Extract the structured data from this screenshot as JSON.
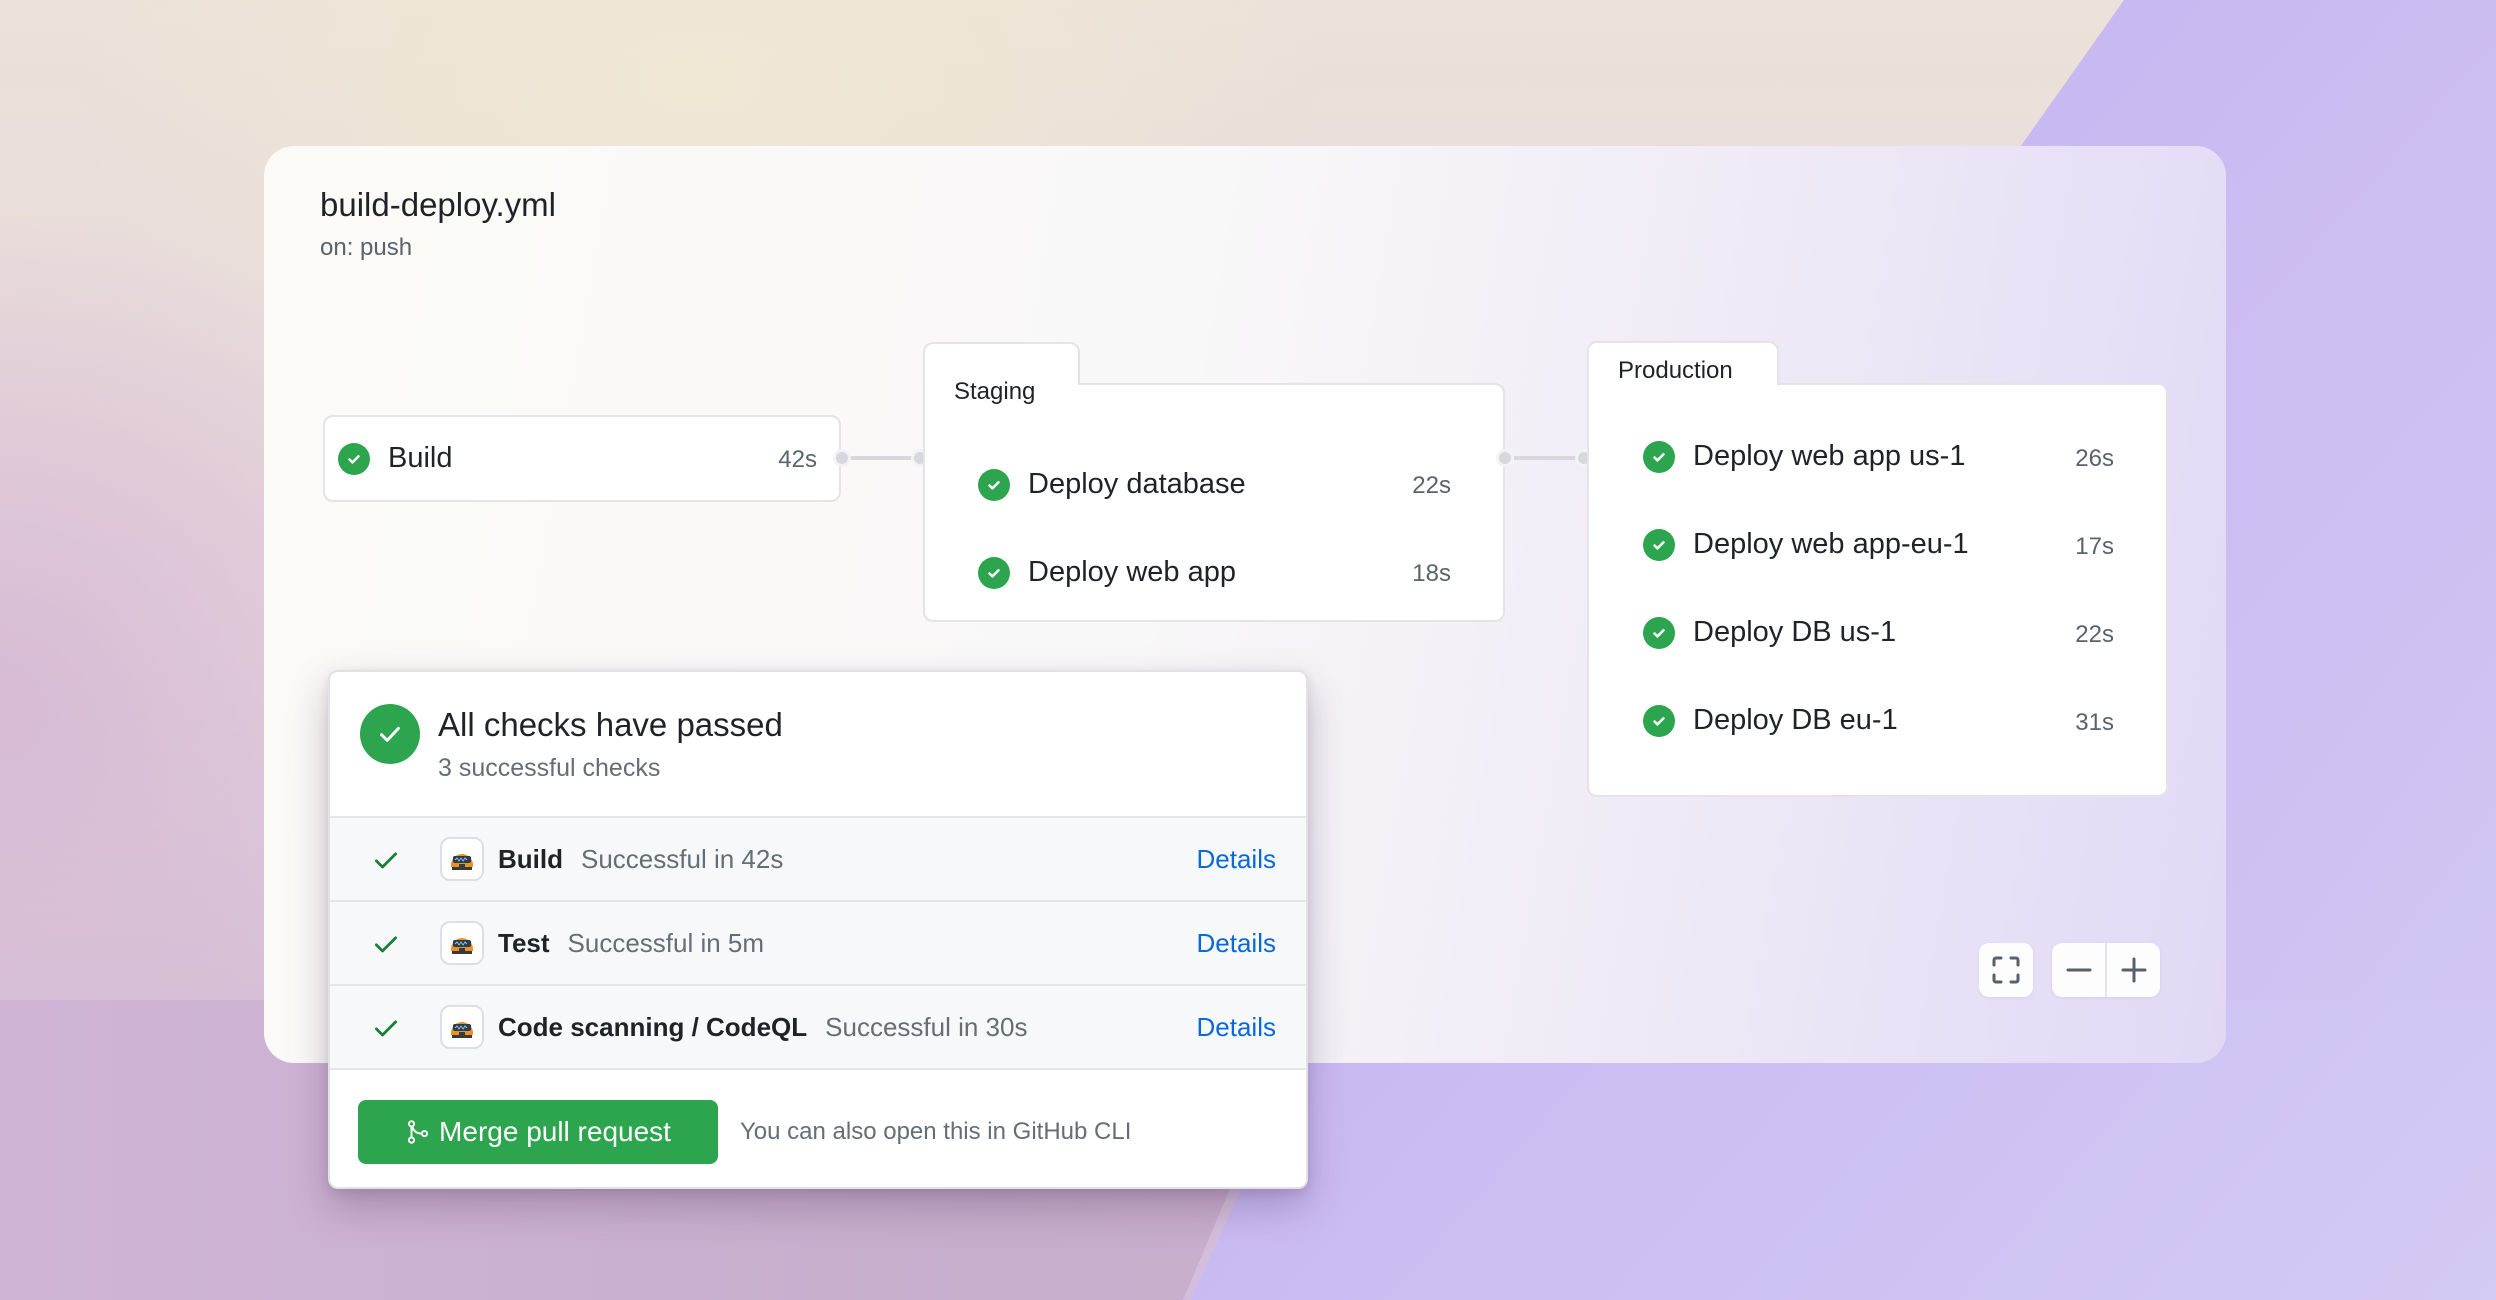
{
  "workflow": {
    "title": "build-deploy.yml",
    "trigger": "on: push"
  },
  "build_job": {
    "name": "Build",
    "duration": "42s",
    "status": "success",
    "icon": "check-circle-icon"
  },
  "groups": [
    {
      "label": "Staging",
      "jobs": [
        {
          "name": "Deploy database",
          "duration": "22s",
          "status": "success"
        },
        {
          "name": "Deploy web app",
          "duration": "18s",
          "status": "success"
        }
      ]
    },
    {
      "label": "Production",
      "jobs": [
        {
          "name": "Deploy web app us-1",
          "duration": "26s",
          "status": "success"
        },
        {
          "name": "Deploy web app-eu-1",
          "duration": "17s",
          "status": "success"
        },
        {
          "name": "Deploy DB us-1",
          "duration": "22s",
          "status": "success"
        },
        {
          "name": "Deploy DB eu-1",
          "duration": "31s",
          "status": "success"
        }
      ]
    }
  ],
  "zoom_controls": {
    "fullscreen_icon": "fullscreen-icon",
    "zoom_out_icon": "minus-icon",
    "zoom_in_icon": "plus-icon"
  },
  "checks": {
    "title": "All checks have passed",
    "subtitle": "3 successful checks",
    "rows": [
      {
        "name": "Build",
        "status": "Successful in 42s",
        "link": "Details"
      },
      {
        "name": "Test",
        "status": "Successful in 5m",
        "link": "Details"
      },
      {
        "name": "Code scanning / CodeQL",
        "status": "Successful in 30s",
        "link": "Details"
      }
    ],
    "merge_button": "Merge pull request",
    "cli_note": "You can also open this in GitHub CLI"
  },
  "colors": {
    "success": "#2da44e",
    "link": "#0969da",
    "text_primary": "#1f2328",
    "text_muted": "#656d76"
  }
}
